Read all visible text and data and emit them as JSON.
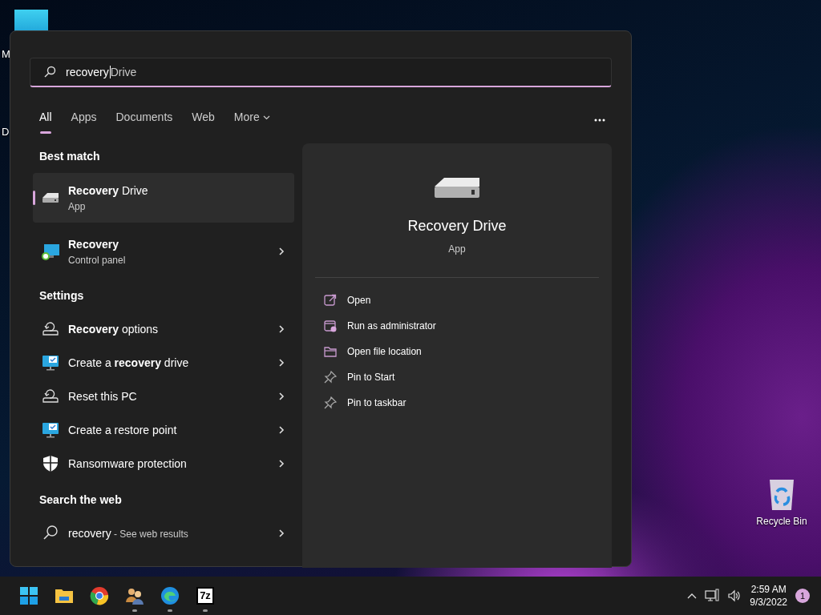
{
  "desktop": {
    "icons": [
      {
        "label": "M"
      },
      {
        "label": "D"
      }
    ],
    "recycle_bin": {
      "label": "Recycle Bin"
    }
  },
  "start_menu": {
    "search": {
      "value": "recovery",
      "suggestion": "Drive"
    },
    "tabs": [
      {
        "label": "All",
        "selected": true,
        "dropdown": false
      },
      {
        "label": "Apps",
        "selected": false,
        "dropdown": false
      },
      {
        "label": "Documents",
        "selected": false,
        "dropdown": false
      },
      {
        "label": "Web",
        "selected": false,
        "dropdown": false
      },
      {
        "label": "More",
        "selected": false,
        "dropdown": true
      }
    ],
    "sections": [
      {
        "title": "Best match",
        "items": [
          {
            "kind": "drive",
            "title": "**Recovery** Drive",
            "subtitle": "App",
            "selected": true,
            "arrow": false
          },
          {
            "kind": "control-panel",
            "title": "**Recovery**",
            "subtitle": "Control panel",
            "selected": false,
            "arrow": true
          }
        ]
      },
      {
        "title": "Settings",
        "items": [
          {
            "kind": "restore",
            "title": "**Recovery** options",
            "selected": false,
            "arrow": true
          },
          {
            "kind": "monitor",
            "title": "Create a **recovery** drive",
            "selected": false,
            "arrow": true
          },
          {
            "kind": "restore",
            "title": "Reset this PC",
            "selected": false,
            "arrow": true
          },
          {
            "kind": "monitor",
            "title": "Create a restore point",
            "selected": false,
            "arrow": true
          },
          {
            "kind": "shield",
            "title": "Ransomware protection",
            "selected": false,
            "arrow": true
          }
        ]
      },
      {
        "title": "Search the web",
        "items": [
          {
            "kind": "web",
            "title": "recovery",
            "suffix": " - See web results",
            "selected": false,
            "arrow": true
          }
        ]
      }
    ],
    "preview": {
      "title": "Recovery Drive",
      "subtitle": "App",
      "actions": [
        {
          "kind": "open",
          "label": "Open"
        },
        {
          "kind": "admin",
          "label": "Run as administrator"
        },
        {
          "kind": "folder",
          "label": "Open file location"
        },
        {
          "kind": "pin",
          "label": "Pin to Start"
        },
        {
          "kind": "pin",
          "label": "Pin to taskbar"
        }
      ]
    }
  },
  "taskbar": {
    "apps": [
      {
        "kind": "start",
        "running": false
      },
      {
        "kind": "folder",
        "running": false
      },
      {
        "kind": "browser",
        "running": false
      },
      {
        "kind": "users",
        "running": true
      },
      {
        "kind": "edge",
        "running": true
      },
      {
        "kind": "archive",
        "label": "7z",
        "running": true
      }
    ],
    "tray": {
      "time": "2:59 AM",
      "date": "9/3/2022",
      "notifications": "1"
    }
  }
}
